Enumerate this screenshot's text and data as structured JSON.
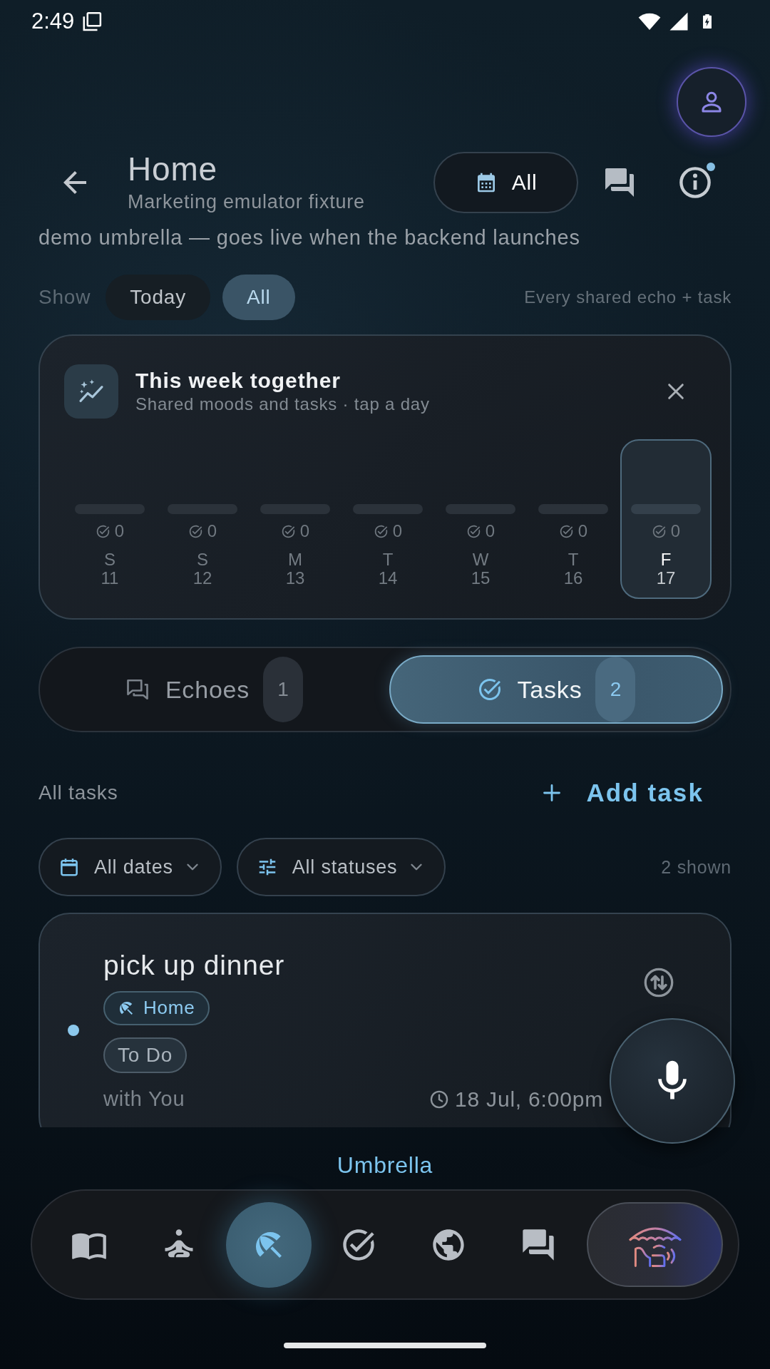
{
  "status_bar": {
    "time": "2:49"
  },
  "header": {
    "title": "Home",
    "subtitle": "Marketing emulator fixture",
    "date_filter": "All",
    "info_badge": true
  },
  "description": "demo umbrella — goes live when the backend launches",
  "show_filter": {
    "label": "Show",
    "options": [
      {
        "label": "Today",
        "selected": false
      },
      {
        "label": "All",
        "selected": true
      }
    ],
    "hint": "Every shared echo + task"
  },
  "week_card": {
    "title": "This week together",
    "subtitle": "Shared moods and tasks · tap a day",
    "days": [
      {
        "letter": "S",
        "date": "11",
        "count": "0",
        "selected": false
      },
      {
        "letter": "S",
        "date": "12",
        "count": "0",
        "selected": false
      },
      {
        "letter": "M",
        "date": "13",
        "count": "0",
        "selected": false
      },
      {
        "letter": "T",
        "date": "14",
        "count": "0",
        "selected": false
      },
      {
        "letter": "W",
        "date": "15",
        "count": "0",
        "selected": false
      },
      {
        "letter": "T",
        "date": "16",
        "count": "0",
        "selected": false
      },
      {
        "letter": "F",
        "date": "17",
        "count": "0",
        "selected": true
      }
    ]
  },
  "segments": [
    {
      "kind": "echoes",
      "label": "Echoes",
      "count": "1",
      "selected": false
    },
    {
      "kind": "tasks",
      "label": "Tasks",
      "count": "2",
      "selected": true
    }
  ],
  "task_list": {
    "title": "All tasks",
    "add_button": "Add task",
    "filters": [
      {
        "kind": "date",
        "label": "All dates"
      },
      {
        "kind": "status",
        "label": "All statuses"
      }
    ],
    "shown": "2 shown",
    "tasks": [
      {
        "title": "pick up dinner",
        "unread": true,
        "space": "Home",
        "status": "To Do",
        "assignee": "with You",
        "due": "18 Jul, 6:00pm"
      }
    ]
  },
  "bottom_nav": {
    "active_label": "Umbrella",
    "items": [
      {
        "kind": "book",
        "selected": false
      },
      {
        "kind": "meditation",
        "selected": false
      },
      {
        "kind": "umbrella",
        "selected": true
      },
      {
        "kind": "check",
        "selected": false
      },
      {
        "kind": "globe",
        "selected": false
      },
      {
        "kind": "chat",
        "selected": false
      },
      {
        "kind": "logo",
        "selected": false
      }
    ]
  }
}
